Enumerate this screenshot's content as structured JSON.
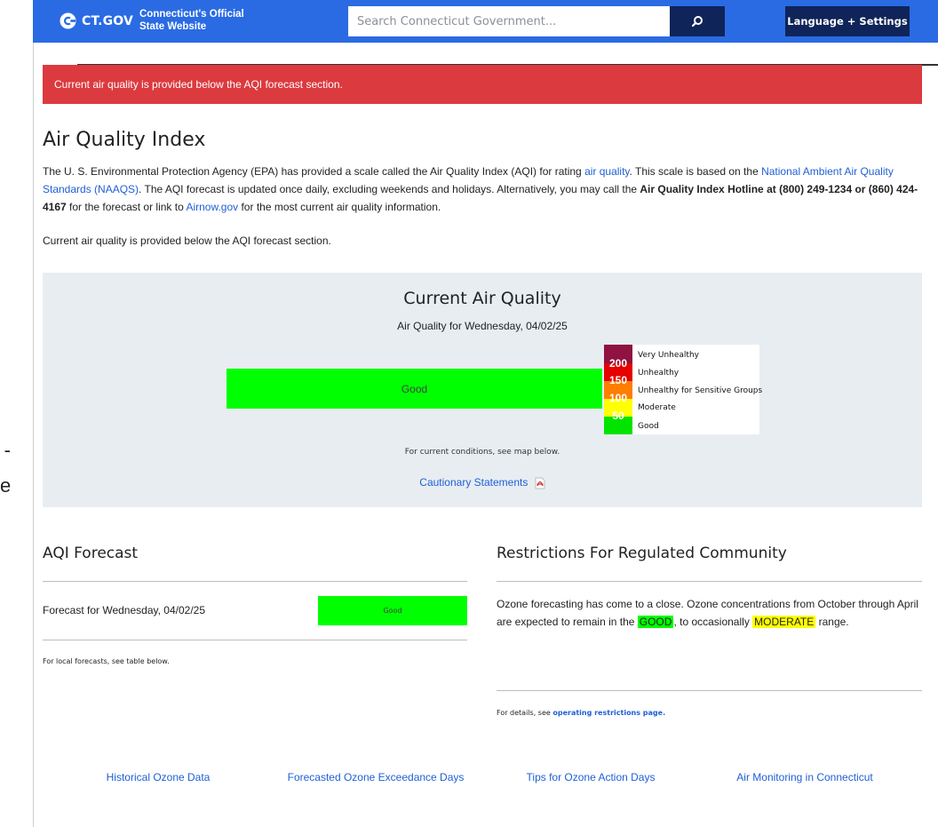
{
  "header": {
    "brand": "CT.GOV",
    "tagline_1": "Connecticut's Official",
    "tagline_2": "State Website",
    "search_placeholder": "Search Connecticut Government...",
    "language_button": "Language + Settings",
    "color": "#2a6be4",
    "button_color": "#0f2458"
  },
  "alert": {
    "text": "Current air quality is provided below the AQI forecast section.",
    "color": "#db3a3f"
  },
  "page": {
    "title": "Air Quality Index",
    "intro": {
      "part1": "The U. S. Environmental Protection Agency (EPA) has provided a scale called the Air Quality Index (AQI) for rating ",
      "link1": "air quality",
      "part2": ". This scale is based on the ",
      "link2": "National Ambient Air Quality Standards (NAAQS)",
      "part3": ". The AQI forecast is updated once daily, excluding weekends and holidays. Alternatively, you may call the ",
      "bold": "Air Quality Index Hotline at (800) 249-1234 or (860) 424-4167",
      "part4": " for the forecast or link to ",
      "link3": "Airnow.gov",
      "part5": " for the most current air quality information."
    },
    "note": "Current air quality is provided below the AQI forecast section."
  },
  "current": {
    "title": "Current Air Quality",
    "date": "Air Quality for Wednesday, 04/02/25",
    "status": "Good",
    "status_color": "#00ff00",
    "legend": [
      {
        "label": "Very Unhealthy"
      },
      {
        "label": "Unhealthy"
      },
      {
        "label": "Unhealthy for Sensitive Groups"
      },
      {
        "label": "Moderate"
      },
      {
        "label": "Good"
      }
    ],
    "scale_numbers": [
      "200",
      "150",
      "100",
      "50"
    ],
    "map_note": "For current conditions, see map below.",
    "caution_link": "Cautionary Statements"
  },
  "forecast": {
    "title": "AQI Forecast",
    "label": "Forecast for Wednesday, 04/02/25",
    "status": "Good",
    "local_note": "For local forecasts, see table below."
  },
  "restrictions": {
    "title": "Restrictions For Regulated Community",
    "text1": "Ozone forecasting has come to a close. Ozone concentrations from October through April are expected to remain in the ",
    "good": "GOOD",
    "text2": ", to occasionally ",
    "moderate": "MODERATE",
    "text3": " range.",
    "details_prefix": "For details, see ",
    "details_link": "operating restrictions page."
  },
  "footer_links": {
    "historical": "Historical Ozone Data",
    "exceedance": "Forecasted Ozone Exceedance Days",
    "tips": "Tips for Ozone Action Days",
    "monitoring": "Air Monitoring in Connecticut"
  }
}
